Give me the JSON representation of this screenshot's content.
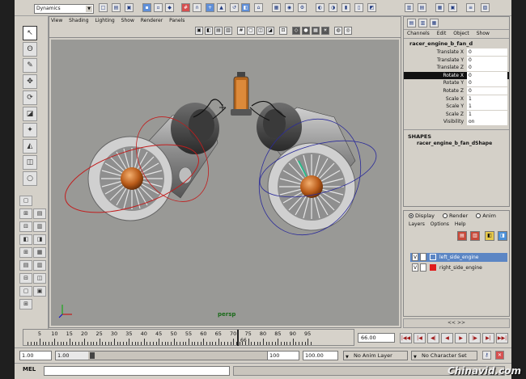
{
  "app": {
    "name": "Maya"
  },
  "topbar": {
    "menu_set": "Dynamics"
  },
  "viewport": {
    "menus": [
      "View",
      "Shading",
      "Lighting",
      "Show",
      "Renderer",
      "Panels"
    ],
    "camera": "persp"
  },
  "channel_box": {
    "menus": [
      "Channels",
      "Edit",
      "Object",
      "Show"
    ],
    "object_name": "racer_engine_b_fan_d",
    "attributes": [
      {
        "name": "Translate X",
        "value": "0"
      },
      {
        "name": "Translate Y",
        "value": "0"
      },
      {
        "name": "Translate Z",
        "value": "0"
      },
      {
        "name": "Rotate X",
        "value": "0"
      },
      {
        "name": "Rotate Y",
        "value": "0"
      },
      {
        "name": "Rotate Z",
        "value": "0"
      },
      {
        "name": "Scale X",
        "value": "1"
      },
      {
        "name": "Scale Y",
        "value": "1"
      },
      {
        "name": "Scale Z",
        "value": "1"
      },
      {
        "name": "Visibility",
        "value": "on"
      }
    ],
    "shapes_heading": "SHAPES",
    "shape_name": "racer_engine_b_fan_dShape"
  },
  "layer_editor": {
    "modes": [
      "Display",
      "Render",
      "Anim"
    ],
    "menus": [
      "Layers",
      "Options",
      "Help"
    ],
    "layers": [
      {
        "visible": "V",
        "name": "left_side_engine",
        "color": "#5c86c4"
      },
      {
        "visible": "V",
        "name": "right_side_engine",
        "color": "#e01b1b"
      }
    ],
    "scroll_arrows": "<<  >>"
  },
  "time_slider": {
    "ticks": [
      "5",
      "10",
      "15",
      "20",
      "25",
      "30",
      "35",
      "40",
      "45",
      "50",
      "55",
      "60",
      "65",
      "70",
      "75",
      "80",
      "85",
      "90",
      "95"
    ],
    "current_frame_marker": "66",
    "current_time": "66.00"
  },
  "playback": {
    "buttons": [
      "|◀◀",
      "|◀",
      "◀|",
      "◀",
      "▶",
      "|▶",
      "▶|",
      "▶▶|"
    ]
  },
  "range_slider": {
    "start": "1.00",
    "inner_start": "1.00",
    "inner_end": "100",
    "end": "100.00",
    "anim_layer": "No Anim Layer",
    "character_set": "No Character Set"
  },
  "command_line": {
    "label": "MEL"
  },
  "watermark": "Chinavid.com",
  "colors": {
    "selected_attr": "#111111",
    "layer_selected": "#5c86c4",
    "viewport_bg": "#999996"
  }
}
